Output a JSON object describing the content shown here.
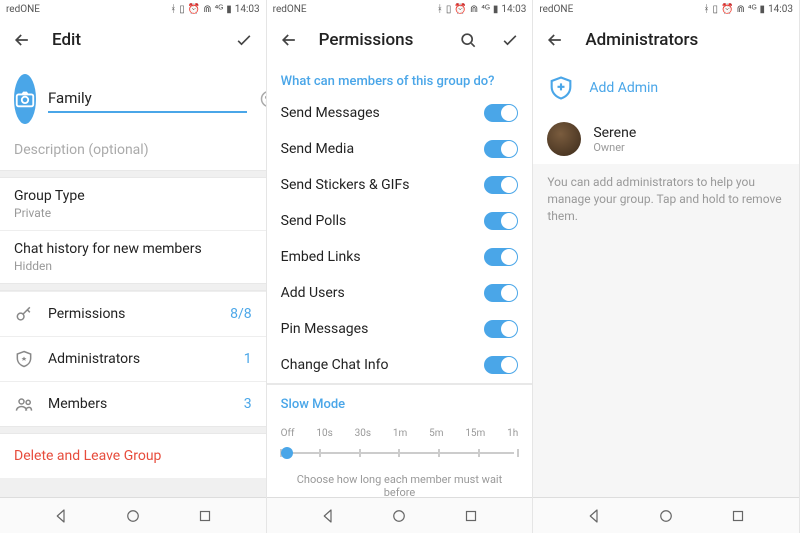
{
  "status": {
    "carrier": "redONE",
    "time": "14:03"
  },
  "panel1": {
    "title": "Edit",
    "group_name": "Family",
    "description_placeholder": "Description (optional)",
    "group_type": {
      "label": "Group Type",
      "value": "Private"
    },
    "chat_history": {
      "label": "Chat history for new members",
      "value": "Hidden"
    },
    "rows": {
      "permissions": {
        "label": "Permissions",
        "value": "8/8"
      },
      "administrators": {
        "label": "Administrators",
        "value": "1"
      },
      "members": {
        "label": "Members",
        "value": "3"
      }
    },
    "delete_label": "Delete and Leave Group"
  },
  "panel2": {
    "title": "Permissions",
    "section_header": "What can members of this group do?",
    "permissions": [
      "Send Messages",
      "Send Media",
      "Send Stickers & GIFs",
      "Send Polls",
      "Embed Links",
      "Add Users",
      "Pin Messages",
      "Change Chat Info"
    ],
    "slow_mode": {
      "label": "Slow Mode",
      "options": [
        "Off",
        "10s",
        "30s",
        "1m",
        "5m",
        "15m",
        "1h"
      ],
      "hint": "Choose how long each member must wait before"
    }
  },
  "panel3": {
    "title": "Administrators",
    "add_admin": "Add Admin",
    "admins": [
      {
        "name": "Serene",
        "role": "Owner"
      }
    ],
    "info": "You can add administrators to help you manage your group. Tap and hold to remove them."
  }
}
